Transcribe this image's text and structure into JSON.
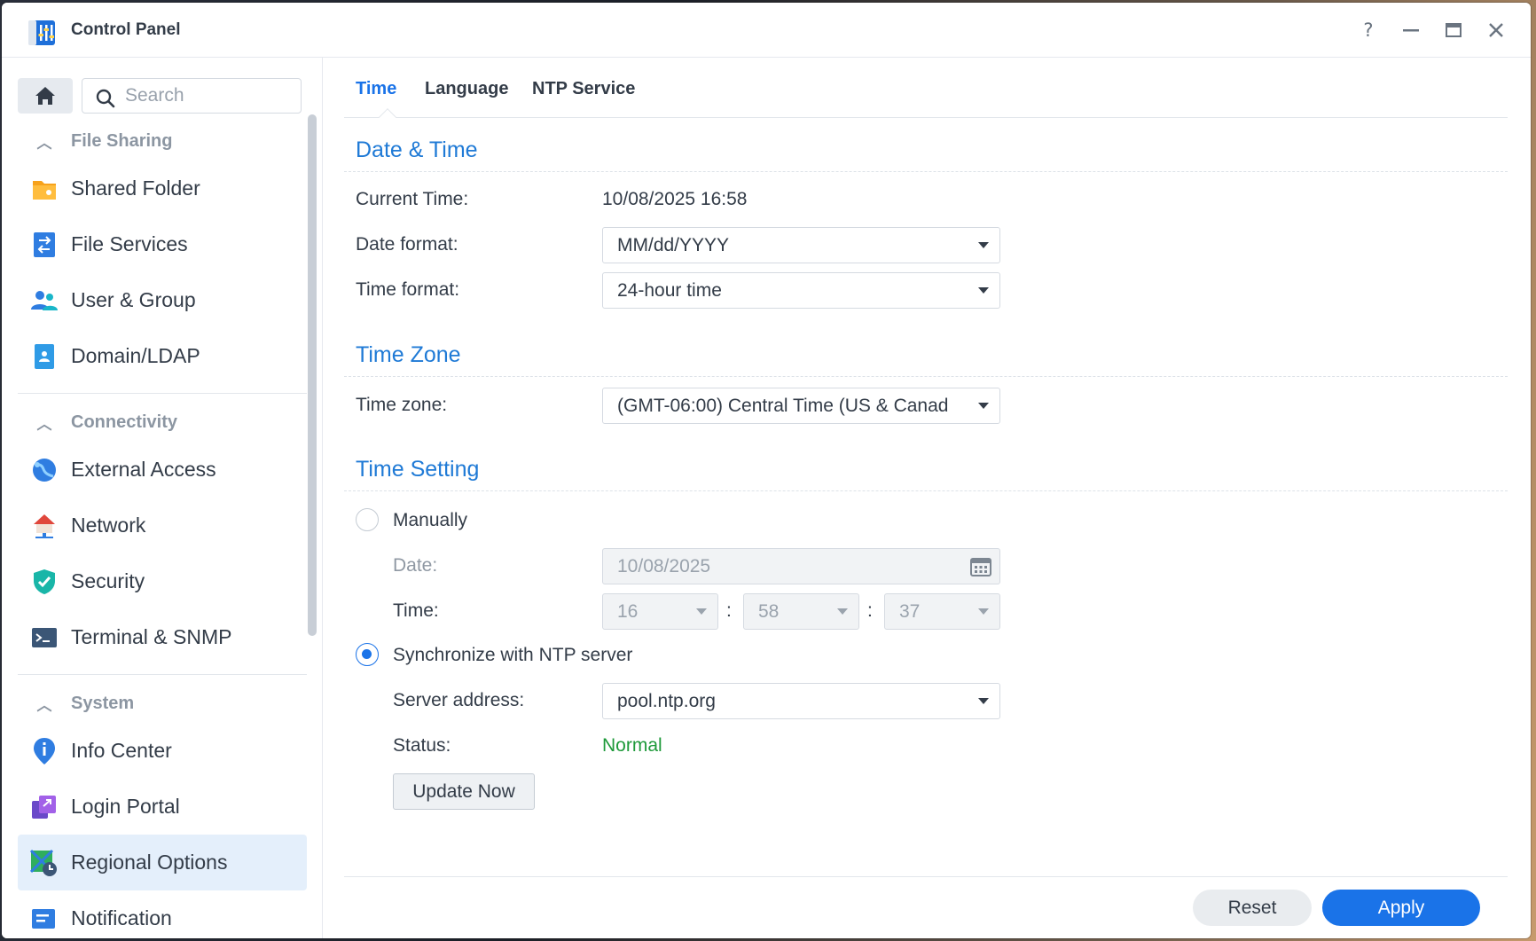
{
  "window": {
    "title": "Control Panel"
  },
  "titlebar": {
    "help": "?",
    "minimize": "–",
    "maximize": "▭",
    "close": "✕"
  },
  "sidebar": {
    "search_placeholder": "Search",
    "groups": [
      {
        "label": "File Sharing",
        "items": [
          {
            "label": "Shared Folder",
            "icon": "shared-folder-icon"
          },
          {
            "label": "File Services",
            "icon": "file-services-icon"
          },
          {
            "label": "User & Group",
            "icon": "user-group-icon"
          },
          {
            "label": "Domain/LDAP",
            "icon": "domain-ldap-icon"
          }
        ]
      },
      {
        "label": "Connectivity",
        "items": [
          {
            "label": "External Access",
            "icon": "external-access-icon"
          },
          {
            "label": "Network",
            "icon": "network-icon"
          },
          {
            "label": "Security",
            "icon": "security-shield-icon"
          },
          {
            "label": "Terminal & SNMP",
            "icon": "terminal-icon"
          }
        ]
      },
      {
        "label": "System",
        "items": [
          {
            "label": "Info Center",
            "icon": "info-center-icon"
          },
          {
            "label": "Login Portal",
            "icon": "login-portal-icon"
          },
          {
            "label": "Regional Options",
            "icon": "regional-options-icon",
            "active": true
          },
          {
            "label": "Notification",
            "icon": "notification-icon"
          }
        ]
      }
    ]
  },
  "tabs": [
    "Time",
    "Language",
    "NTP Service"
  ],
  "date_time": {
    "title": "Date & Time",
    "current_time_label": "Current Time:",
    "current_time_value": "10/08/2025 16:58",
    "date_format_label": "Date format:",
    "date_format_value": "MM/dd/YYYY",
    "time_format_label": "Time format:",
    "time_format_value": "24-hour time"
  },
  "time_zone": {
    "title": "Time Zone",
    "label": "Time zone:",
    "value": "(GMT-06:00) Central Time (US & Canad"
  },
  "time_setting": {
    "title": "Time Setting",
    "manually_label": "Manually",
    "date_label": "Date:",
    "date_value": "10/08/2025",
    "time_label": "Time:",
    "hour": "16",
    "minute": "58",
    "second": "37",
    "separator": ":",
    "ntp_label": "Synchronize with NTP server",
    "server_label": "Server address:",
    "server_value": "pool.ntp.org",
    "status_label": "Status:",
    "status_value": "Normal",
    "update_button": "Update Now"
  },
  "footer": {
    "reset": "Reset",
    "apply": "Apply"
  },
  "colors": {
    "accent": "#1a73e8",
    "section": "#1f7ad6",
    "status_ok": "#1e9a3a",
    "active_item_bg": "#e4effb"
  }
}
